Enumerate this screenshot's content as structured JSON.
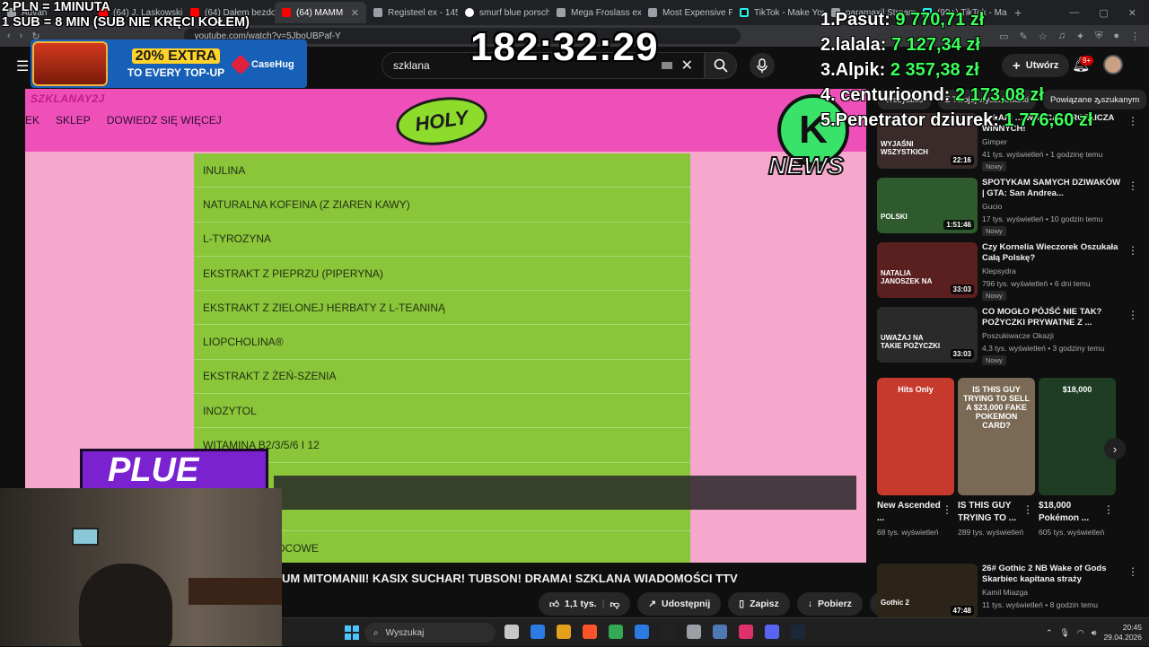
{
  "browser": {
    "tabs": [
      {
        "label": "Advan",
        "fav": "other"
      },
      {
        "label": "(64) J. Laskowski 2B",
        "fav": "yt"
      },
      {
        "label": "(64) Dałem bezdom",
        "fav": "yt"
      },
      {
        "label": "(64) MAMM",
        "fav": "yt",
        "active": true
      },
      {
        "label": "Registeel ex - 145/",
        "fav": "other"
      },
      {
        "label": "smurf blue porsche",
        "fav": "g"
      },
      {
        "label": "Mega Froslass ex -",
        "fav": "other"
      },
      {
        "label": "Most Expensive Pok",
        "fav": "other"
      },
      {
        "label": "TikTok - Make Your",
        "fav": "tt"
      },
      {
        "label": "paramaxil Stream",
        "fav": "other"
      },
      {
        "label": "(99+) TikTok - Make",
        "fav": "tt"
      }
    ],
    "url": "youtube.com/watch?v=5JboUBPaf-Y"
  },
  "youtube": {
    "search_value": "szklana",
    "create_label": "Utwórz",
    "notif_badge": "9+"
  },
  "overlays": {
    "rate_line1": "2 PLN =  1MINUTA",
    "rate_line2": "1 SUB = 8 MIN (SUB NIE KRĘCI KOŁEM)",
    "timer": "182:32:29",
    "promo_pct": "20% EXTRA",
    "promo_sub": "TO EVERY TOP-UP",
    "promo_brand": "CaseHug",
    "leaderboard": [
      {
        "name": "1.Pasut:",
        "value": "9 770,71 zł"
      },
      {
        "name": "2.lalala:",
        "value": "7 127,34 zł"
      },
      {
        "name": "3.Alpik:",
        "value": "2 357,38 zł"
      },
      {
        "name": "4. centurioond:",
        "value": "2 173,08 zł"
      },
      {
        "name": "5.Penetrator dziurek:",
        "value": "1 776,60 zł"
      }
    ]
  },
  "video_frame": {
    "brand_text": "SZKLANAY2J",
    "nav": [
      "EK",
      "SKLEP",
      "DOWIEDZ SIĘ WIĘCEJ"
    ],
    "logo": "HOLY",
    "news_k": "K",
    "news_text": "NEWS",
    "plue_text": "PLUE",
    "ingredients": [
      "INULINA",
      "NATURALNA KOFEINA (Z ZIAREN KAWY)",
      "L-TYROZYNA",
      "EKSTRAKT Z PIEPRZU (PIPERYNA)",
      "EKSTRAKT Z ZIELONEJ HERBATY Z L-TEANINĄ",
      "LIOPCHOLINA®",
      "EKSTRAKT Z ŻEŃ-SZENIA",
      "INOZYTOL",
      "WITAMINA B2/3/5/6 I 12",
      "",
      "",
      "AROMATY OWOCOWE"
    ]
  },
  "video_title": "UM MITOMANII! KASIX SUCHAR! TUBSON! DRAMA! SZKLANA WIADOMOŚCI TTV",
  "actions": {
    "likes": "1,1 tys.",
    "share": "Udostępnij",
    "save": "Zapisz",
    "download": "Pobierz"
  },
  "sidebar": {
    "chips": [
      "Wszystkie",
      "Z Twojej wyszukiwarki",
      "Powiązane z szukanym",
      "Z kanału"
    ],
    "recommendations": [
      {
        "title": "… ŁAPI … WRACA … ROZLICZA WINNYCH!",
        "channel": "Gimper",
        "meta": "41 tys. wyświetleń • 1 godzinę temu",
        "duration": "22:16",
        "new": "Nowy",
        "thumb_text": "WYJAŚNI WSZYSTKICH"
      },
      {
        "title": "SPOTYKAM SAMYCH DZIWAKÓW | GTA: San Andrea...",
        "channel": "Gucio",
        "meta": "17 tys. wyświetleń • 10 godzin temu",
        "duration": "1:51:46",
        "new": "Nowy",
        "thumb_text": "POLSKI"
      },
      {
        "title": "Czy Kornelia Wieczorek Oszukała Całą Polskę?",
        "channel": "Klepsydra",
        "meta": "796 tys. wyświetleń • 6 dni temu",
        "duration": "33:03",
        "new": "Nowy",
        "thumb_text": "NATALIA JANOSZEK NA"
      },
      {
        "title": "CO MOGŁO PÓJŚĆ NIE TAK? POŻYCZKI PRYWATNE Z ...",
        "channel": "Poszukiwacze Okazji",
        "meta": "4,3 tys. wyświetleń • 3 godziny temu",
        "duration": "33:03",
        "new": "Nowy",
        "thumb_text": "UWAŻAJ NA TAKIE POŻYCZKI"
      }
    ],
    "shorts": [
      {
        "title": "New Ascended ...",
        "views": "68 tys. wyświetleń",
        "thumb_text": "Hits Only"
      },
      {
        "title": "IS THIS GUY TRYING TO ...",
        "views": "289 tys. wyświetleń",
        "thumb_text": "IS THIS GUY TRYING TO SELL A $23,000 FAKE POKEMON CARD?"
      },
      {
        "title": "$18,000 Pokémon ...",
        "views": "605 tys. wyświetleń",
        "thumb_text": "$18,000"
      }
    ],
    "bottom_rec": {
      "title": "26# Gothic 2 NB Wake of Gods Skarbiec kapitana straży",
      "channel": "Kamil Miazga",
      "meta": "11 tys. wyświetleń • 8 godzin temu",
      "duration": "47:48",
      "thumb_text": "Gothic 2"
    }
  },
  "taskbar": {
    "search_placeholder": "Wyszukaj",
    "time": "20:45",
    "date": "29.04.2026",
    "app_colors": [
      "#c7c7c7",
      "#2c7be5",
      "#e3a01b",
      "#fb542b",
      "#34a853",
      "#2a7ae2",
      "#222",
      "#9aa0a6",
      "#4f79b5",
      "#e0306c",
      "#5865f2",
      "#1b2838"
    ]
  },
  "colors": {
    "video_pink_header": "#ef4fb9",
    "video_pink_bg": "#f6a7cc",
    "ingredient_green": "#8ac53a",
    "leaderboard_value": "#3dff5a"
  }
}
